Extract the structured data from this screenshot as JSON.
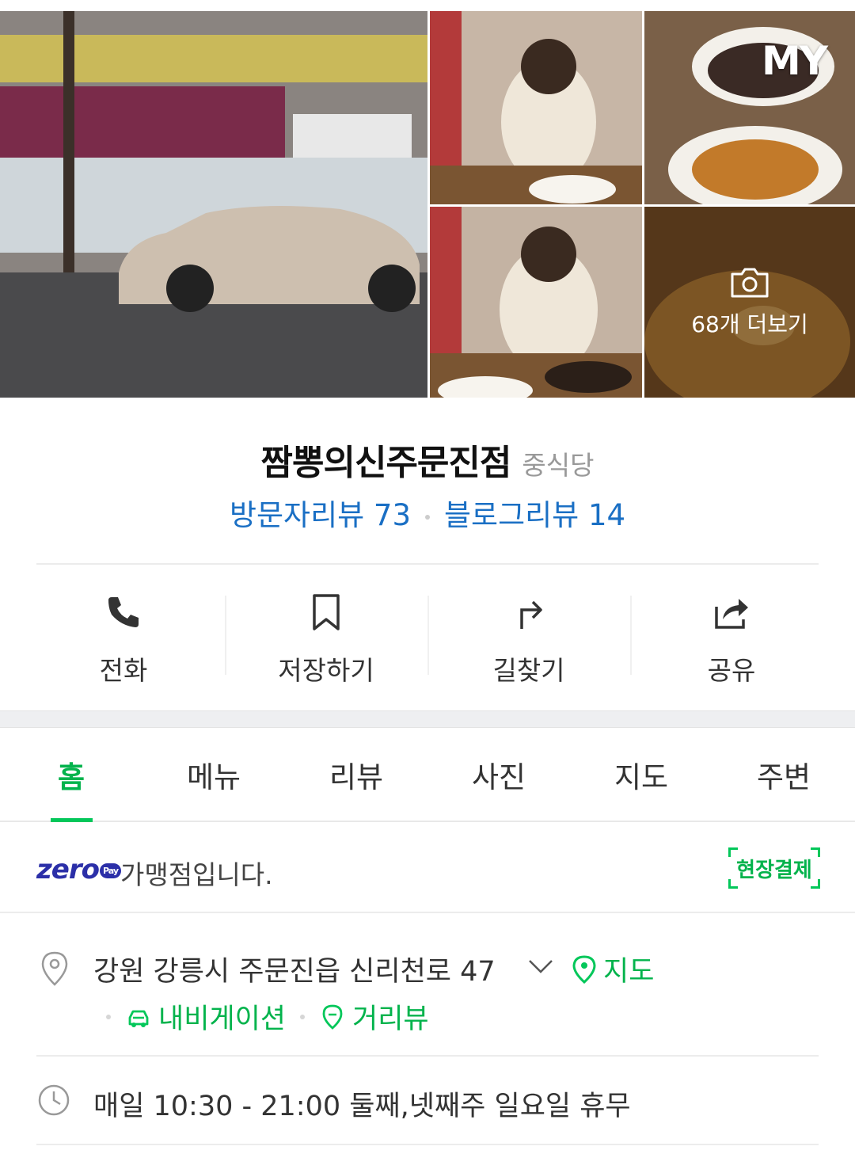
{
  "photos": {
    "main_alt": "storefront",
    "my_badge": "MY",
    "more_label": "68개 더보기"
  },
  "place": {
    "name": "짬뽕의신주문진점",
    "category": "중식당",
    "visitor_reviews_label": "방문자리뷰 73",
    "blog_reviews_label": "블로그리뷰 14"
  },
  "actions": [
    {
      "label": "전화",
      "icon": "phone-icon"
    },
    {
      "label": "저장하기",
      "icon": "bookmark-icon"
    },
    {
      "label": "길찾기",
      "icon": "directions-icon"
    },
    {
      "label": "공유",
      "icon": "share-icon"
    }
  ],
  "tabs": [
    {
      "label": "홈",
      "active": true
    },
    {
      "label": "메뉴",
      "active": false
    },
    {
      "label": "리뷰",
      "active": false
    },
    {
      "label": "사진",
      "active": false
    },
    {
      "label": "지도",
      "active": false
    },
    {
      "label": "주변",
      "active": false
    }
  ],
  "zeropay": {
    "logo": "zero",
    "logo_sub": "Pay",
    "text": "가맹점입니다.",
    "badge": "현장결제"
  },
  "address": {
    "text": "강원 강릉시 주문진읍 신리천로 47",
    "map_link": "지도",
    "navigation_link": "내비게이션",
    "street_view_link": "거리뷰"
  },
  "hours": {
    "text": "매일 10:30 - 21:00 둘째,넷째주 일요일 휴무"
  },
  "colors": {
    "accent_green": "#03c75a",
    "link_blue": "#1a6fc4",
    "zeropay_navy": "#2b2fa8"
  }
}
